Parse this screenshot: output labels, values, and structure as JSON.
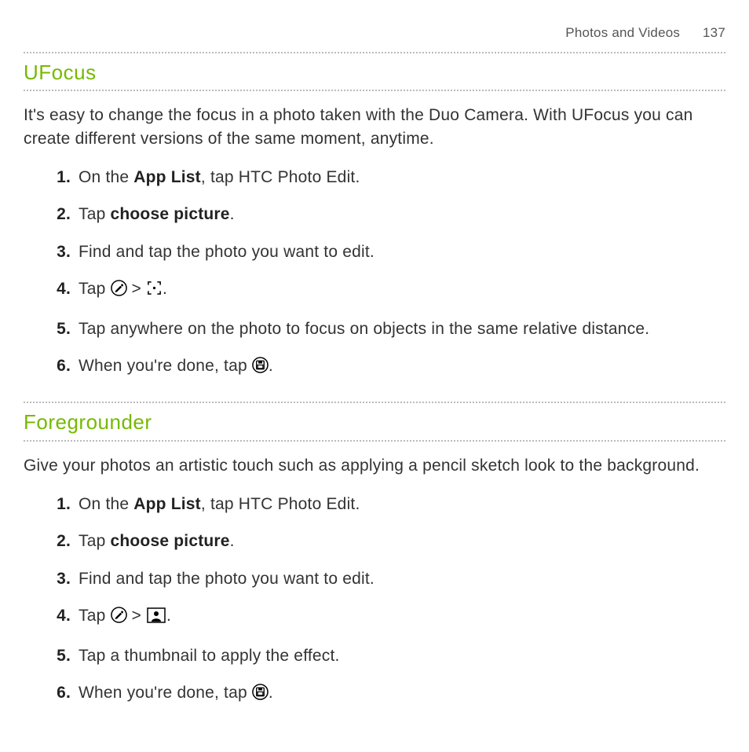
{
  "header": {
    "chapter": "Photos and Videos",
    "page": "137"
  },
  "sections": [
    {
      "title": "UFocus",
      "intro": "It's easy to change the focus in a photo taken with the Duo Camera. With UFocus you can create different versions of the same moment, anytime.",
      "steps": [
        {
          "runs": [
            {
              "t": "On the "
            },
            {
              "t": "App List",
              "b": true
            },
            {
              "t": ", tap HTC Photo Edit."
            }
          ]
        },
        {
          "runs": [
            {
              "t": "Tap "
            },
            {
              "t": "choose picture",
              "b": true
            },
            {
              "t": "."
            }
          ]
        },
        {
          "runs": [
            {
              "t": "Find and tap the photo you want to edit."
            }
          ]
        },
        {
          "runs": [
            {
              "t": "Tap "
            },
            {
              "icon": "edit-circle-icon"
            },
            {
              "t": " > "
            },
            {
              "icon": "focus-bracket-icon"
            },
            {
              "t": "."
            }
          ]
        },
        {
          "runs": [
            {
              "t": "Tap anywhere on the photo to focus on objects in the same relative distance."
            }
          ]
        },
        {
          "runs": [
            {
              "t": "When you're done, tap "
            },
            {
              "icon": "save-circle-icon"
            },
            {
              "t": "."
            }
          ]
        }
      ]
    },
    {
      "title": "Foregrounder",
      "intro": "Give your photos an artistic touch such as applying a pencil sketch look to the background.",
      "steps": [
        {
          "runs": [
            {
              "t": "On the "
            },
            {
              "t": "App List",
              "b": true
            },
            {
              "t": ", tap HTC Photo Edit."
            }
          ]
        },
        {
          "runs": [
            {
              "t": "Tap "
            },
            {
              "t": "choose picture",
              "b": true
            },
            {
              "t": "."
            }
          ]
        },
        {
          "runs": [
            {
              "t": "Find and tap the photo you want to edit."
            }
          ]
        },
        {
          "runs": [
            {
              "t": "Tap "
            },
            {
              "icon": "edit-circle-icon"
            },
            {
              "t": " > "
            },
            {
              "icon": "person-frame-icon"
            },
            {
              "t": "."
            }
          ]
        },
        {
          "runs": [
            {
              "t": "Tap a thumbnail to apply the effect."
            }
          ]
        },
        {
          "runs": [
            {
              "t": "When you're done, tap "
            },
            {
              "icon": "save-circle-icon"
            },
            {
              "t": "."
            }
          ]
        }
      ]
    }
  ]
}
